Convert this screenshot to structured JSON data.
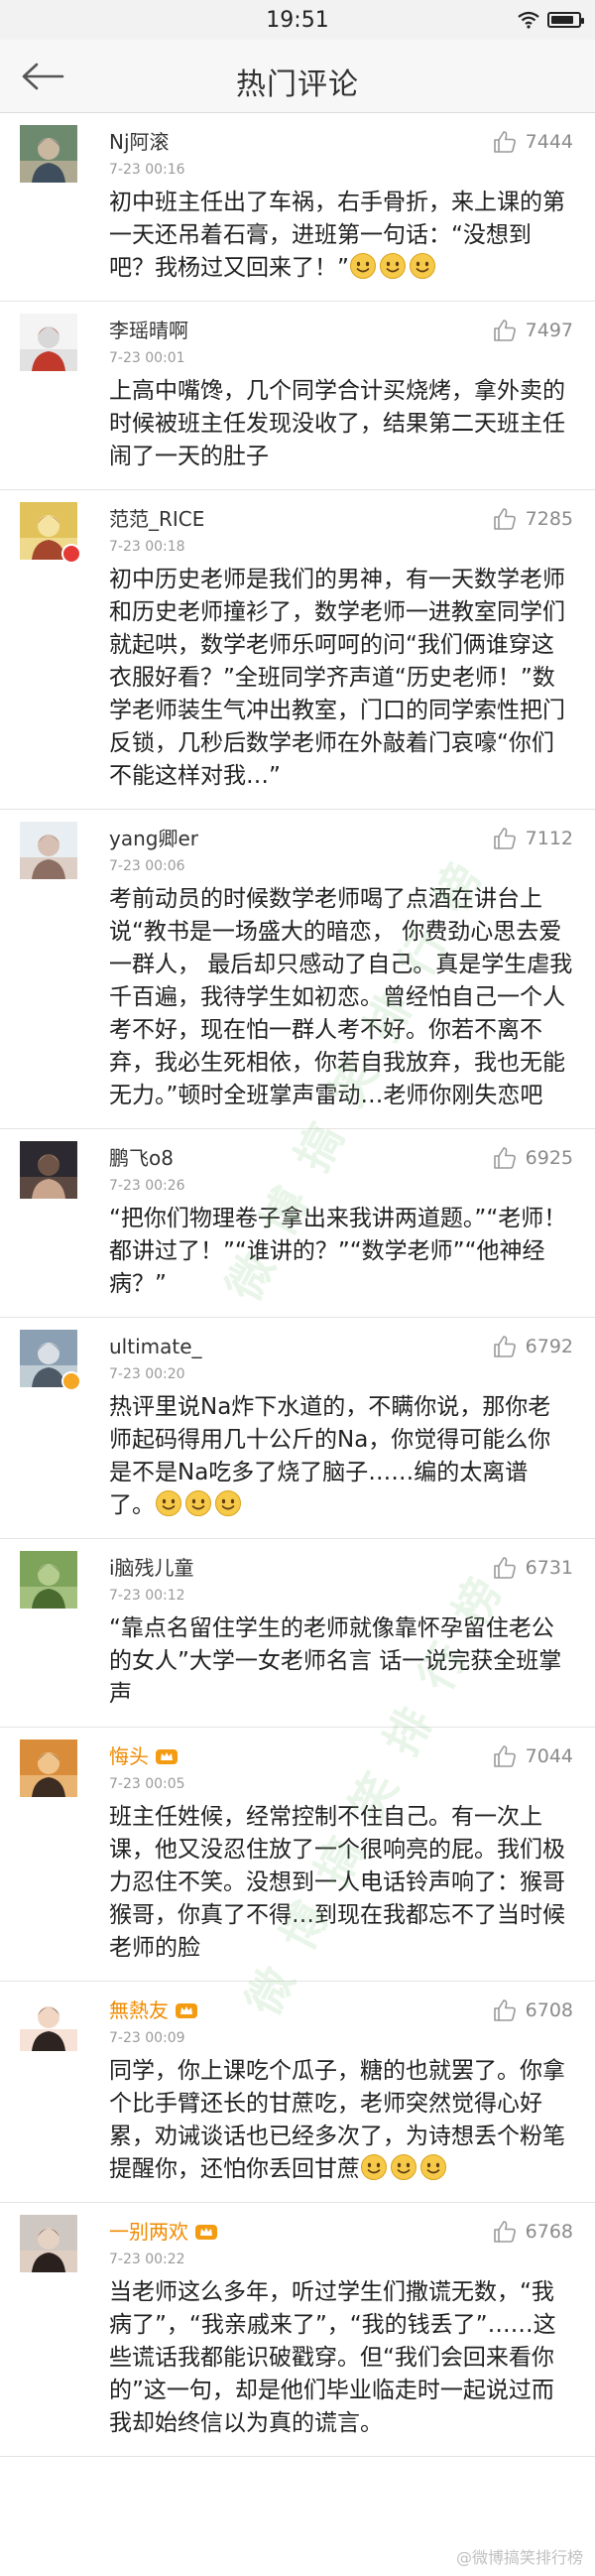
{
  "status_bar": {
    "time": "19:51",
    "battery_level": 0.85
  },
  "nav": {
    "title": "热门评论"
  },
  "watermark": {
    "text": "微 博 搞 笑 排 行 榜",
    "footer": "@微博搞笑排行榜"
  },
  "colors": {
    "accent_vip": "#f08a00",
    "muted": "#9a9a9a",
    "divider": "#e3e3e3"
  },
  "comments": [
    {
      "username": "Nj阿滚",
      "time": "7-23 00:16",
      "likes": "7444",
      "avatar": "avatar-scarf-photo",
      "text": "初中班主任出了车祸，右手骨折，来上课的第一天还吊着石膏，进班第一句话：“没想到吧？我杨过又回来了！”",
      "emoji_count": 3
    },
    {
      "username": "李瑶晴啊",
      "time": "7-23 00:01",
      "likes": "7497",
      "avatar": "avatar-sketch",
      "text": "上高中嘴馋，几个同学合计买烧烤，拿外卖的时候被班主任发现没收了，结果第二天班主任闹了一天的肚子",
      "emoji_count": 0
    },
    {
      "username": "范范_RICE",
      "time": "7-23 00:18",
      "likes": "7285",
      "avatar": "avatar-yellow-wall",
      "text": "初中历史老师是我们的男神，有一天数学老师和历史老师撞衫了，数学老师一进教室同学们就起哄，数学老师乐呵呵的问“我们俩谁穿这衣服好看？”全班同学齐声道“历史老师！”数学老师装生气冲出教室，门口的同学索性把门反锁，几秒后数学老师在外敲着门哀嚎“你们不能这样对我…”",
      "emoji_count": 0,
      "badge": "red"
    },
    {
      "username": "yang卿er",
      "time": "7-23 00:06",
      "likes": "7112",
      "avatar": "avatar-girl-light",
      "text": "考前动员的时候数学老师喝了点酒在讲台上说“教书是一场盛大的暗恋， 你费劲心思去爱一群人， 最后却只感动了自己。真是学生虐我千百遍，我待学生如初恋。曾经怕自己一个人考不好，现在怕一群人考不好。你若不离不弃，我必生死相依，你若自我放弃，我也无能无力。”顿时全班掌声雷动…老师你刚失恋吧",
      "emoji_count": 0
    },
    {
      "username": "鹏飞o8",
      "time": "7-23 00:26",
      "likes": "6925",
      "avatar": "avatar-dark-boy",
      "text": "“把你们物理卷子拿出来我讲两道题。”“老师！都讲过了！”“谁讲的？”“数学老师”“他神经病？”",
      "emoji_count": 0
    },
    {
      "username": "ultimate_",
      "time": "7-23 00:20",
      "likes": "6792",
      "avatar": "avatar-street",
      "text": "热评里说Na炸下水道的，不瞒你说，那你老师起码得用几十公斤的Na，你觉得可能么你是不是Na吃多了烧了脑子……编的太离谱了。",
      "emoji_count": 3,
      "badge": "yellow"
    },
    {
      "username": "i脑残儿童",
      "time": "7-23 00:12",
      "likes": "6731",
      "avatar": "avatar-green-park",
      "text": "“靠点名留住学生的老师就像靠怀孕留住老公的女人”大学一女老师名言  话一说完获全班掌声",
      "emoji_count": 0
    },
    {
      "username": "悔头",
      "time": "7-23 00:05",
      "likes": "7044",
      "avatar": "avatar-boy-orange",
      "vip": true,
      "text": "班主任姓候，经常控制不住自己。有一次上课，他又没忍住放了一个很响亮的屁。我们极力忍住不笑。没想到一人电话铃声响了：猴哥猴哥，你真了不得…到现在我都忘不了当时候老师的脸",
      "emoji_count": 0
    },
    {
      "username": "無熱友",
      "time": "7-23 00:09",
      "likes": "6708",
      "avatar": "avatar-cartoon-boy",
      "vip": true,
      "text": "同学，你上课吃个瓜子，糖的也就罢了。你拿个比手臂还长的甘蔗吃，老师突然觉得心好累，劝诫谈话也已经多次了，为诗想丢个粉笔提醒你，还怕你丢回甘蔗",
      "emoji_count": 3
    },
    {
      "username": "一别两欢",
      "time": "7-23 00:22",
      "likes": "6768",
      "avatar": "avatar-boy-portrait",
      "vip": true,
      "text": "当老师这么多年，听过学生们撒谎无数，“我病了”，“我亲戚来了”，“我的钱丢了”……这些谎话我都能识破戳穿。但“我们会回来看你的”这一句，却是他们毕业临走时一起说过而我却始终信以为真的谎言。",
      "emoji_count": 0
    }
  ]
}
